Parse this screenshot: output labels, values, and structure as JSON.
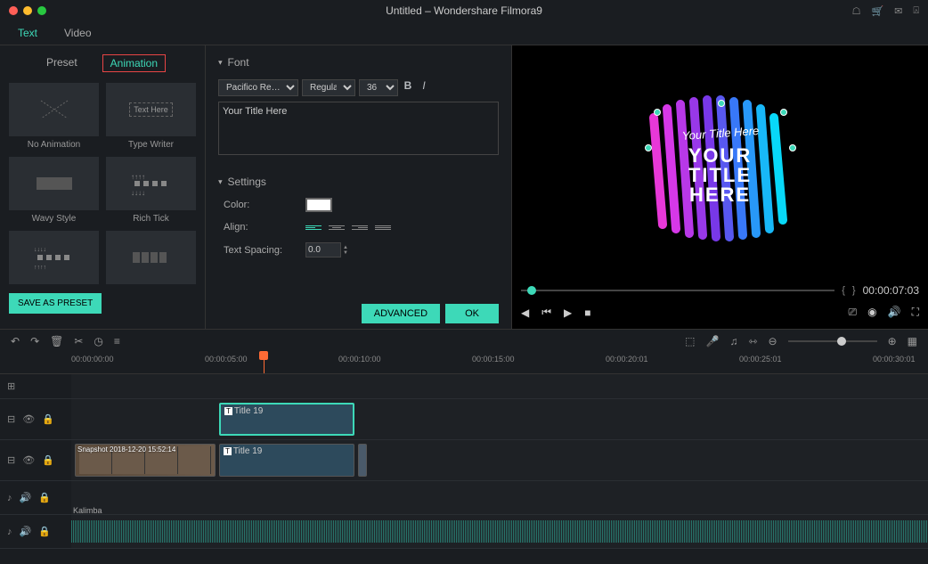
{
  "window": {
    "title": "Untitled – Wondershare Filmora9"
  },
  "tabs": {
    "text": "Text",
    "video": "Video"
  },
  "subtabs": {
    "preset": "Preset",
    "animation": "Animation"
  },
  "presets": [
    {
      "label": "No Animation"
    },
    {
      "label": "Type Writer",
      "thumb": "Text Here"
    },
    {
      "label": "Wavy Style"
    },
    {
      "label": "Rich Tick"
    },
    {
      "label": ""
    },
    {
      "label": ""
    }
  ],
  "save_preset": "SAVE AS PRESET",
  "font": {
    "section": "Font",
    "family": "Pacifico Re…",
    "weight": "Regular",
    "size": "36",
    "text_value": "Your Title Here"
  },
  "settings": {
    "section": "Settings",
    "color": "Color:",
    "align": "Align:",
    "spacing": "Text Spacing:",
    "spacing_value": "0.0"
  },
  "buttons": {
    "advanced": "ADVANCED",
    "ok": "OK"
  },
  "preview": {
    "script": "Your Title Here",
    "line1": "YOUR",
    "line2": "TITLE",
    "line3": "HERE",
    "timecode": "00:00:07:03"
  },
  "ruler": [
    "00:00:00:00",
    "00:00:05:00",
    "00:00:10:00",
    "00:00:15:00",
    "00:00:20:01",
    "00:00:25:01",
    "00:00:30:01"
  ],
  "clips": {
    "title1": "Title 19",
    "title2": "Title 19",
    "snapshot": "Snapshot 2018-12-20 15:52:14",
    "audio": "Kalimba"
  }
}
